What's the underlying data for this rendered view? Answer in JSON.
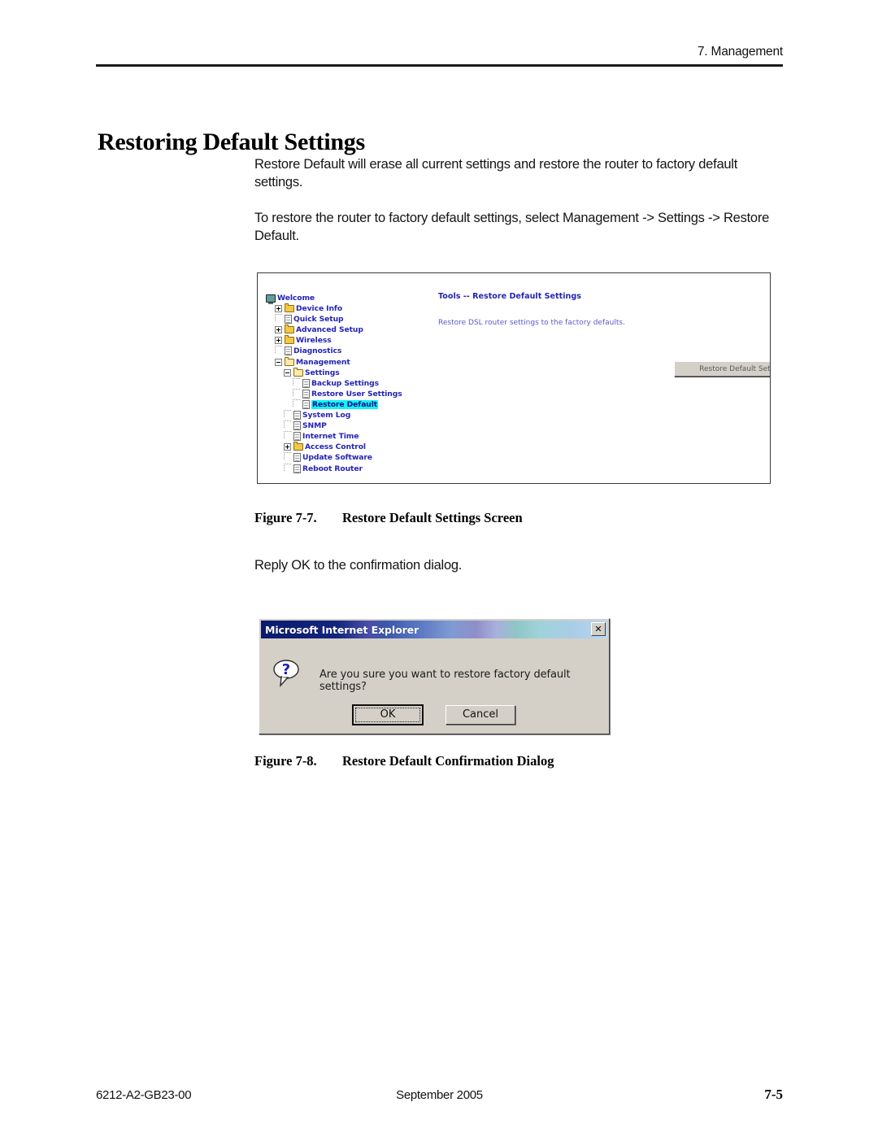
{
  "page": {
    "header_text": "7. Management",
    "title": "Restoring Default Settings",
    "paragraphs": [
      "Restore Default will erase all current settings and restore the router to factory default settings.",
      "To restore the router to factory default settings, select Management -> Settings -> Restore Default."
    ],
    "reply_note": "Reply OK to the confirmation dialog."
  },
  "figure_7_7": {
    "number": "Figure 7-7.",
    "caption": "Restore Default Settings Screen"
  },
  "figure_7_8": {
    "number": "Figure 7-8.",
    "caption": "Restore Default Confirmation Dialog"
  },
  "router_ui": {
    "tree": [
      {
        "label": "Welcome",
        "icon": "monitor-icon",
        "indent": 0,
        "connector": "none",
        "expander": "none",
        "selected": false
      },
      {
        "label": "Device Info",
        "icon": "folder-icon",
        "indent": 1,
        "connector": "none",
        "expander": "plus",
        "selected": false
      },
      {
        "label": "Quick Setup",
        "icon": "page-icon",
        "indent": 1,
        "connector": "dots",
        "expander": "none",
        "selected": false
      },
      {
        "label": "Advanced Setup",
        "icon": "folder-icon",
        "indent": 1,
        "connector": "none",
        "expander": "plus",
        "selected": false
      },
      {
        "label": "Wireless",
        "icon": "folder-icon",
        "indent": 1,
        "connector": "none",
        "expander": "plus",
        "selected": false
      },
      {
        "label": "Diagnostics",
        "icon": "page-icon",
        "indent": 1,
        "connector": "dots",
        "expander": "none",
        "selected": false
      },
      {
        "label": "Management",
        "icon": "folder-open-icon",
        "indent": 1,
        "connector": "none",
        "expander": "minus",
        "selected": false
      },
      {
        "label": "Settings",
        "icon": "folder-open-icon",
        "indent": 2,
        "connector": "none",
        "expander": "minus",
        "selected": false
      },
      {
        "label": "Backup Settings",
        "icon": "page-icon",
        "indent": 3,
        "connector": "dots",
        "expander": "none",
        "selected": false
      },
      {
        "label": "Restore User Settings",
        "icon": "page-icon",
        "indent": 3,
        "connector": "dots",
        "expander": "none",
        "selected": false
      },
      {
        "label": "Restore Default",
        "icon": "page-icon",
        "indent": 3,
        "connector": "dots",
        "expander": "none",
        "selected": true
      },
      {
        "label": "System Log",
        "icon": "page-icon",
        "indent": 2,
        "connector": "dots",
        "expander": "none",
        "selected": false
      },
      {
        "label": "SNMP",
        "icon": "page-icon",
        "indent": 2,
        "connector": "dots",
        "expander": "none",
        "selected": false
      },
      {
        "label": "Internet Time",
        "icon": "page-icon",
        "indent": 2,
        "connector": "dots",
        "expander": "none",
        "selected": false
      },
      {
        "label": "Access Control",
        "icon": "folder-icon",
        "indent": 2,
        "connector": "none",
        "expander": "plus",
        "selected": false
      },
      {
        "label": "Update Software",
        "icon": "page-icon",
        "indent": 2,
        "connector": "dots",
        "expander": "none",
        "selected": false
      },
      {
        "label": "Reboot Router",
        "icon": "page-icon",
        "indent": 2,
        "connector": "dots",
        "expander": "none",
        "selected": false
      }
    ],
    "panel": {
      "title": "Tools -- Restore Default Settings",
      "description": "Restore DSL router settings to the factory defaults.",
      "button_label": "Restore Default Settings"
    },
    "colors": {
      "link_blue": "#2424b4",
      "text_blue": "#5a5ac8",
      "selection_cyan": "#10f6f6",
      "folder_yellow": "#f5c842",
      "button_face": "#d4d0c8"
    }
  },
  "dialog": {
    "title": "Microsoft Internet Explorer",
    "close_label": "✕",
    "icon": "question-bubble-icon",
    "message": "Are you sure you want to restore factory default settings?",
    "ok_label": "OK",
    "cancel_label": "Cancel",
    "colors": {
      "titlebar_start": "#0a1a6e",
      "titlebar_end": "#b6d8ef",
      "face": "#d4d0c8",
      "question_blue": "#1c1cc8"
    }
  },
  "footer": {
    "doc_number": "6212-A2-GB23-00",
    "date": "September 2005",
    "page_number": "7-5"
  }
}
